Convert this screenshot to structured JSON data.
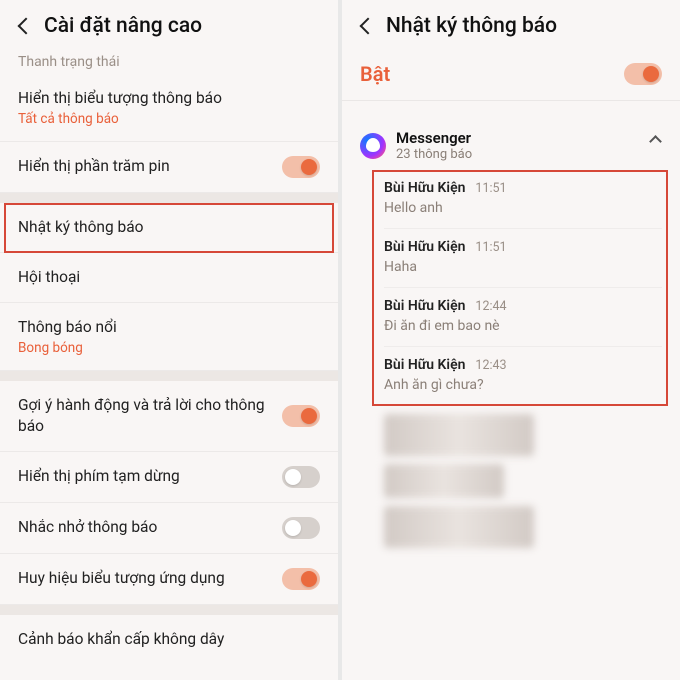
{
  "left": {
    "header": "Cài đặt nâng cao",
    "section_label": "Thanh trạng thái",
    "rows": {
      "show_icon_title": "Hiển thị biểu tượng thông báo",
      "show_icon_sub": "Tất cả thông báo",
      "battery_pct": "Hiển thị phần trăm pin",
      "notif_log": "Nhật ký thông báo",
      "conversation": "Hội thoại",
      "floating_title": "Thông báo nổi",
      "floating_sub": "Bong bóng",
      "suggest": "Gợi ý hành động và trả lời cho thông báo",
      "pause": "Hiển thị phím tạm dừng",
      "remind": "Nhắc nhở thông báo",
      "badge": "Huy hiệu biểu tượng ứng dụng",
      "emergency": "Cảnh báo khẩn cấp không dây"
    }
  },
  "right": {
    "header": "Nhật ký thông báo",
    "master_label": "Bật",
    "app_name": "Messenger",
    "app_sub": "23 thông báo",
    "notifs": [
      {
        "sender": "Bùi Hữu Kiện",
        "time": "11:51",
        "body": "Hello anh"
      },
      {
        "sender": "Bùi Hữu Kiện",
        "time": "11:51",
        "body": "Haha"
      },
      {
        "sender": "Bùi Hữu Kiện",
        "time": "12:44",
        "body": "Đi ăn đi em bao nè"
      },
      {
        "sender": "Bùi Hữu Kiện",
        "time": "12:43",
        "body": "Anh ăn gì chưa?"
      }
    ]
  }
}
